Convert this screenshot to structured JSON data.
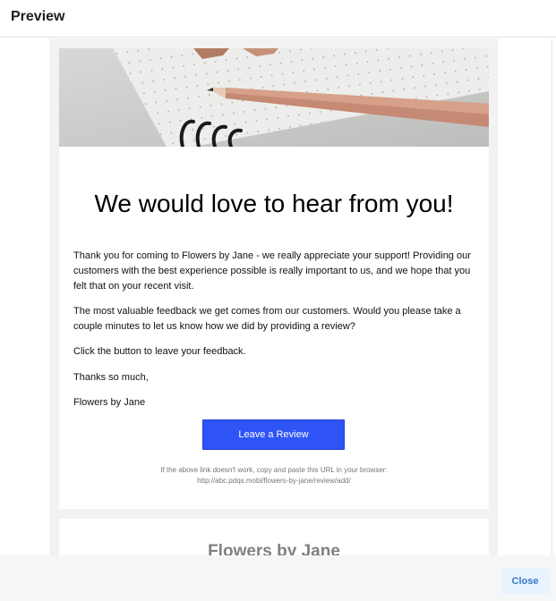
{
  "modal": {
    "title": "Preview",
    "close_label": "Close"
  },
  "email": {
    "headline": "We would love to hear from you!",
    "paragraphs": [
      "Thank you for coming to Flowers by Jane - we really appreciate your support! Providing our customers with the best experience possible is really important to us, and we hope that you felt that on your recent visit.",
      "The most valuable feedback we get comes from our customers. Would you please take a couple minutes to let us know how we did by providing a review?",
      "Click the button to leave your feedback.",
      "Thanks so much,",
      "Flowers by Jane"
    ],
    "button_label": "Leave a Review",
    "fallback_note": "If the above link doesn't work, copy and paste this URL in your browser:",
    "fallback_url": "http://abc.pdqs.mobi/flowers-by-jane/review/add/",
    "footer_business_name": "Flowers by Jane"
  },
  "colors": {
    "button": "#2f54f5",
    "close_text": "#3b78c4",
    "close_bg": "#e7f3ff"
  }
}
